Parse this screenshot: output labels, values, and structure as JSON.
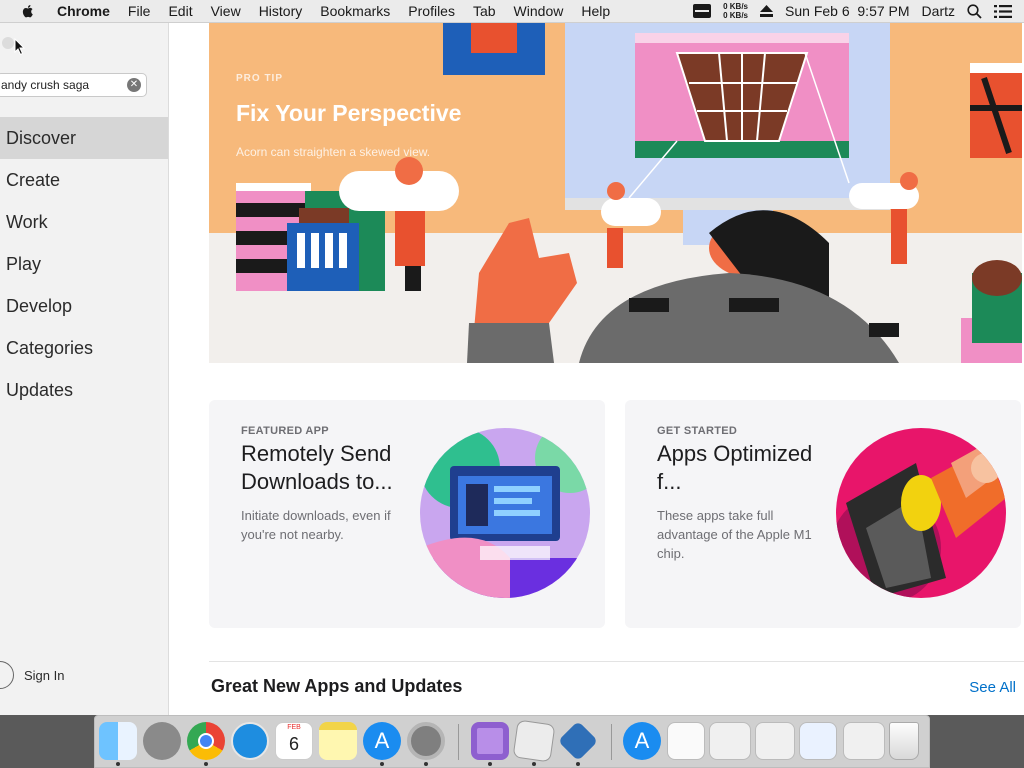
{
  "menubar": {
    "items": [
      "Chrome",
      "File",
      "Edit",
      "View",
      "History",
      "Bookmarks",
      "Profiles",
      "Tab",
      "Window",
      "Help"
    ],
    "net_up": "0 KB/s",
    "net_down": "0 KB/s",
    "datetime": "Sun Feb 6  9:57 PM",
    "user": "Dartz"
  },
  "sidebar": {
    "search_value": "andy crush saga",
    "items": [
      {
        "label": "Discover",
        "active": true
      },
      {
        "label": "Create"
      },
      {
        "label": "Work"
      },
      {
        "label": "Play"
      },
      {
        "label": "Develop"
      },
      {
        "label": "Categories"
      },
      {
        "label": "Updates"
      }
    ],
    "sign_in": "Sign In"
  },
  "hero": {
    "tag": "PRO TIP",
    "title": "Fix Your Perspective",
    "subtitle": "Acorn can straighten a skewed view."
  },
  "cards": [
    {
      "tag": "FEATURED APP",
      "title": "Remotely Send Downloads to...",
      "desc": "Initiate downloads, even if you're not nearby."
    },
    {
      "tag": "GET STARTED",
      "title": "Apps Optimized f...",
      "desc": "These apps take full advantage of the Apple M1 chip."
    }
  ],
  "section": {
    "title": "Great New Apps and Updates",
    "see_all": "See All"
  },
  "dock": {
    "calendar_month": "FEB",
    "calendar_day": "6"
  },
  "colors": {
    "accent": "#0070c9",
    "hero_bg": "#f7b97b",
    "sidebar_selected": "#d6d6d6"
  }
}
